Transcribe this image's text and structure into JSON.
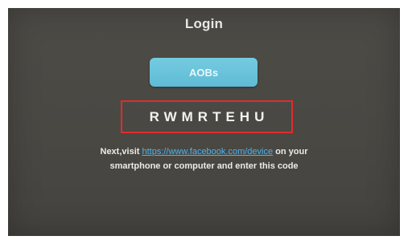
{
  "screen": {
    "title": "Login",
    "code_button_label": "AOBs",
    "device_code": "RWMRTEHU",
    "instructions": {
      "prefix": "Next,visit ",
      "link": "https://www.facebook.com/device",
      "suffix_line1": " on your",
      "line2": "smartphone or computer and enter this code"
    }
  },
  "colors": {
    "background": "#4a4843",
    "button": "#66c1d8",
    "highlight_box": "#e22b2b",
    "link": "#4ab4f0"
  }
}
